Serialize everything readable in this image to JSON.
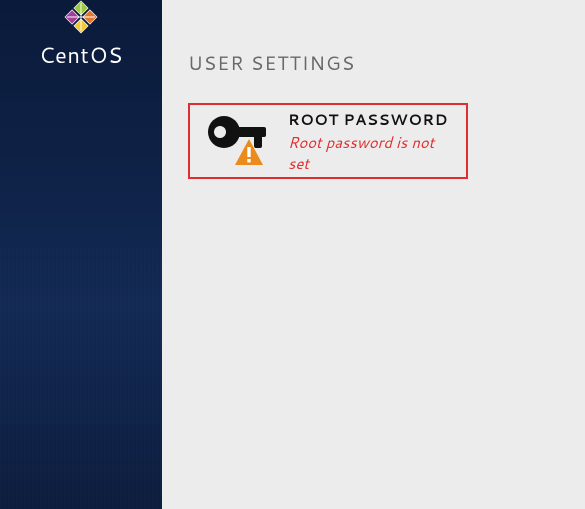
{
  "sidebar": {
    "brand": "CentOS"
  },
  "main": {
    "section_title": "USER SETTINGS",
    "root_password": {
      "title": "ROOT PASSWORD",
      "status": "Root password is not set"
    }
  },
  "colors": {
    "error": "#e12d2d",
    "warning": "#eb8b1b"
  }
}
